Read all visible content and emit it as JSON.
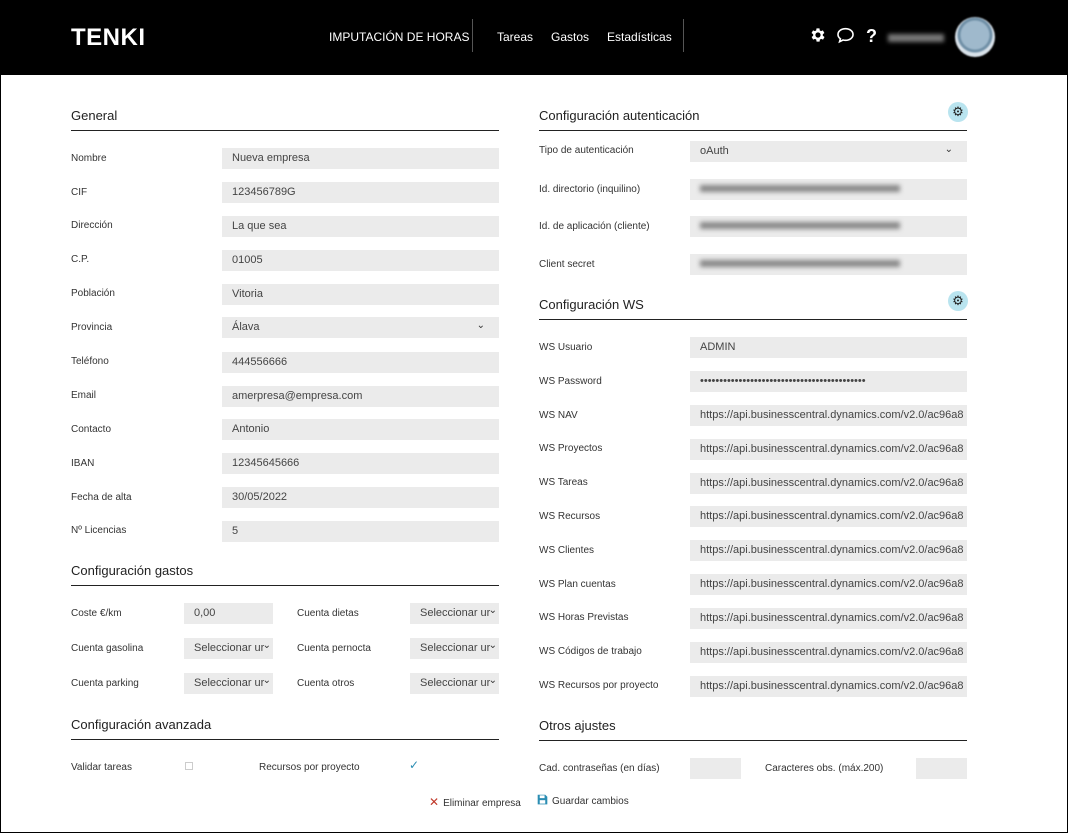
{
  "header": {
    "logo": "TENKI",
    "nav": [
      "IMPUTACIÓN DE HORAS",
      "Tareas",
      "Gastos",
      "Estadísticas"
    ],
    "icons": [
      "gear-icon",
      "chat-icon",
      "help-icon"
    ],
    "help_glyph": "?"
  },
  "general": {
    "title": "General",
    "fields": [
      {
        "label": "Nombre",
        "value": "Nueva empresa"
      },
      {
        "label": "CIF",
        "value": "123456789G"
      },
      {
        "label": "Dirección",
        "value": "La que sea"
      },
      {
        "label": "C.P.",
        "value": "01005"
      },
      {
        "label": "Población",
        "value": "Vitoria"
      },
      {
        "label": "Provincia",
        "value": "Álava"
      },
      {
        "label": "Teléfono",
        "value": "444556666"
      },
      {
        "label": "Email",
        "value": "amerpresa@empresa.com"
      },
      {
        "label": "Contacto",
        "value": "Antonio"
      },
      {
        "label": "IBAN",
        "value": "12345645666"
      },
      {
        "label": "Fecha de alta",
        "value": "30/05/2022"
      },
      {
        "label": "Nº Licencias",
        "value": "5"
      }
    ]
  },
  "gastos": {
    "title": "Configuración gastos",
    "coste_label": "Coste €/km",
    "coste_value": "0,00",
    "gasolina_label": "Cuenta gasolina",
    "parking_label": "Cuenta parking",
    "dietas_label": "Cuenta dietas",
    "pernocta_label": "Cuenta pernocta",
    "otros_label": "Cuenta otros",
    "select_value": "Seleccionar ur"
  },
  "avanzada": {
    "title": "Configuración avanzada",
    "validar_label": "Validar tareas",
    "validar_checked": false,
    "recursos_label": "Recursos por proyecto",
    "recursos_checked": true
  },
  "actions": {
    "delete_label": "Eliminar empresa",
    "save_label": "Guardar cambios"
  },
  "auth": {
    "title": "Configuración autenticación",
    "tipo_label": "Tipo de autenticación",
    "tipo_value": "oAuth",
    "directorio_label": "Id. directorio (inquilino)",
    "aplicacion_label": "Id. de aplicación (cliente)",
    "secret_label": "Client secret"
  },
  "ws": {
    "title": "Configuración WS",
    "usuario_label": "WS Usuario",
    "usuario_value": "ADMIN",
    "password_label": "WS Password",
    "password_value": "•••••••••••••••••••••••••••••••••••••••••••",
    "url_value": "https://api.businesscentral.dynamics.com/v2.0/ac96a8",
    "url_fields": [
      "WS NAV",
      "WS Proyectos",
      "WS Tareas",
      "WS Recursos",
      "WS Clientes",
      "WS Plan cuentas",
      "WS Horas Previstas",
      "WS Códigos de trabajo",
      "WS Recursos por proyecto"
    ]
  },
  "otros": {
    "title": "Otros ajustes",
    "contrasenas_label": "Cad. contraseñas (en días)",
    "contrasenas_value": "",
    "caracteres_label": "Caracteres obs. (máx.200)",
    "caracteres_value": ""
  }
}
